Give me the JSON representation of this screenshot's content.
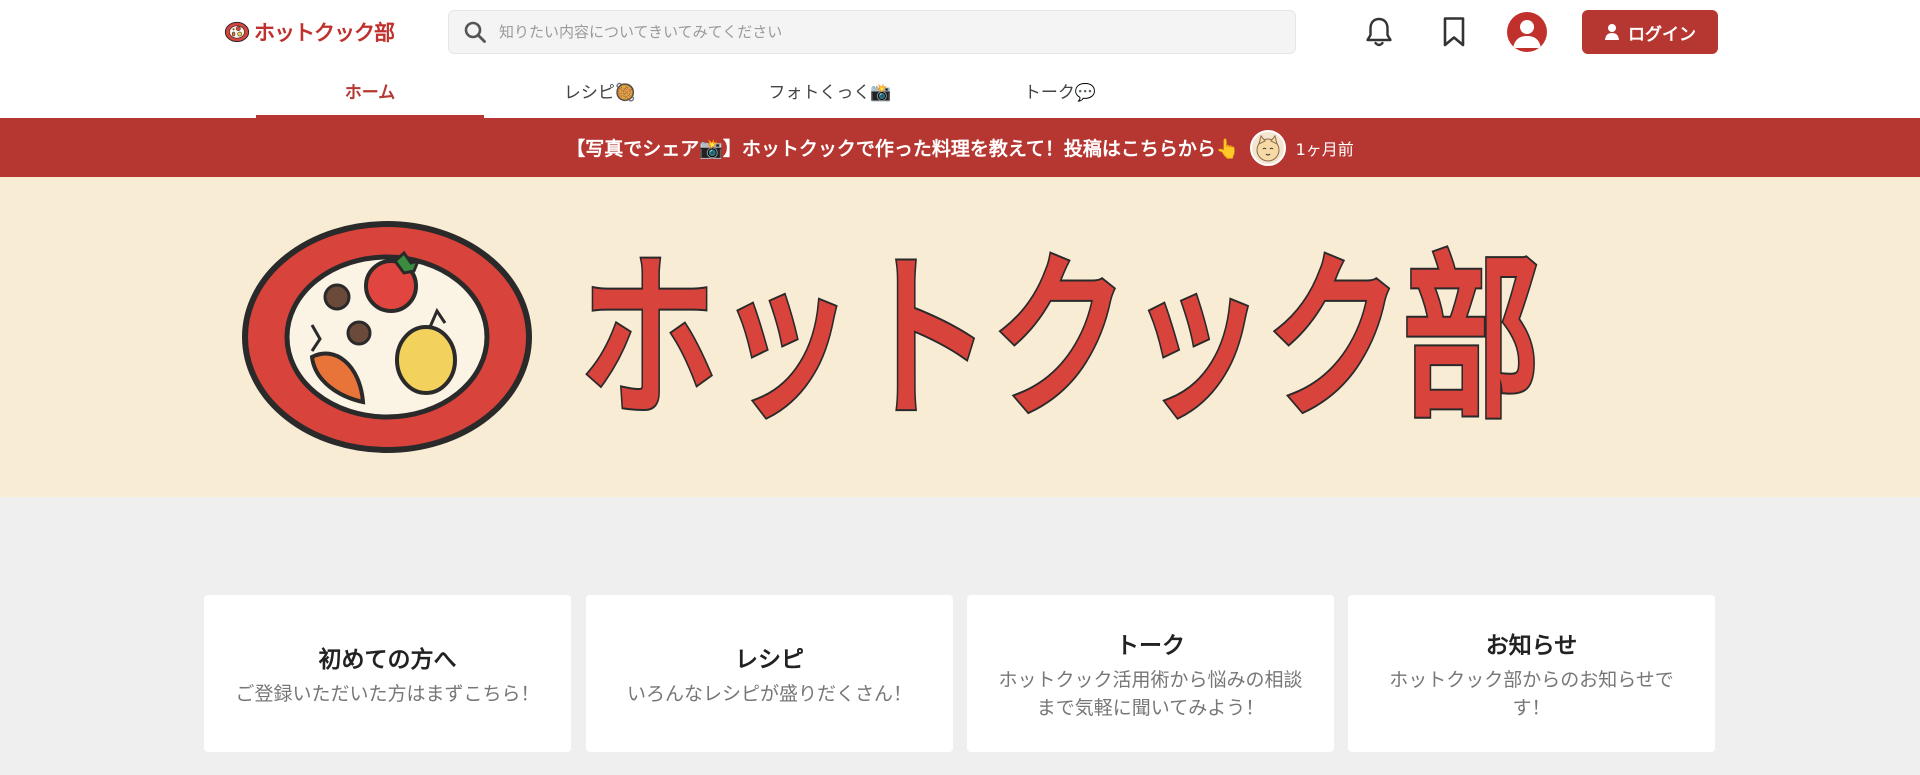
{
  "header": {
    "brand": "ホットクック部",
    "search_placeholder": "知りたい内容についてきいてみてください",
    "login_label": "ログイン"
  },
  "tabs": [
    {
      "label": "ホーム",
      "active": true
    },
    {
      "label": "レシピ🥘",
      "active": false
    },
    {
      "label": "フォトくっく📸",
      "active": false
    },
    {
      "label": "トーク💬",
      "active": false
    }
  ],
  "announcement": {
    "text": "【写真でシェア📸】ホットクックで作った料理を教えて！投稿はこちらから👆",
    "time": "1ヶ月前"
  },
  "hero": {
    "title": "ホットクック部"
  },
  "cards": [
    {
      "title": "初めての方へ",
      "desc": "ご登録いただいた方はまずこちら！"
    },
    {
      "title": "レシピ",
      "desc": "いろんなレシピが盛りだくさん！"
    },
    {
      "title": "トーク",
      "desc": "ホットクック活用術から悩みの相談まで気軽に聞いてみよう！"
    },
    {
      "title": "お知らせ",
      "desc": "ホットクック部からのお知らせです！"
    }
  ],
  "colors": {
    "brand_red": "#b63631",
    "hero_bg": "#f8ecd5"
  }
}
